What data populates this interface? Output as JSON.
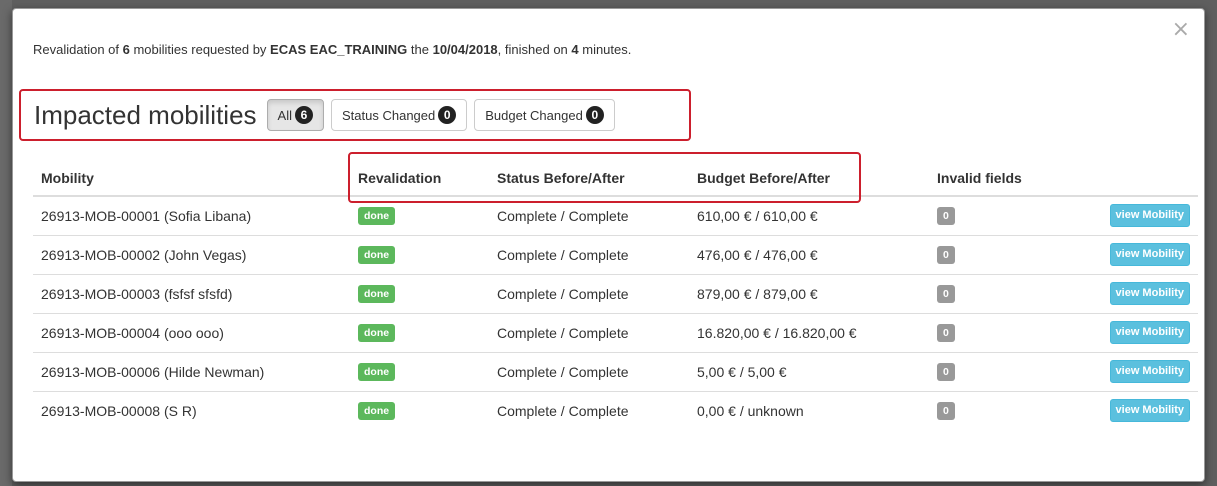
{
  "summary": {
    "prefix": "Revalidation of ",
    "count": "6",
    "middle": " mobilities requested by ",
    "requester": "ECAS EAC_TRAINING",
    "the": " the ",
    "date": "10/04/2018",
    "finished": ", finished on ",
    "minutes": "4",
    "suffix": " minutes."
  },
  "close_glyph": "×",
  "heading": "Impacted mobilities",
  "tabs": [
    {
      "label": "All",
      "count": "6"
    },
    {
      "label": "Status Changed",
      "count": "0"
    },
    {
      "label": "Budget Changed",
      "count": "0"
    }
  ],
  "table": {
    "headers": [
      "Mobility",
      "Revalidation",
      "Status Before/After",
      "Budget Before/After",
      "Invalid fields"
    ],
    "rows": [
      {
        "mobility": "26913-MOB-00001 (Sofia Libana)",
        "revalidation": "done",
        "status": "Complete / Complete",
        "budget": "610,00 € / 610,00 €",
        "invalid": "0",
        "action": "view Mobility"
      },
      {
        "mobility": "26913-MOB-00002 (John Vegas)",
        "revalidation": "done",
        "status": "Complete / Complete",
        "budget": "476,00 € / 476,00 €",
        "invalid": "0",
        "action": "view Mobility"
      },
      {
        "mobility": "26913-MOB-00003 (fsfsf sfsfd)",
        "revalidation": "done",
        "status": "Complete / Complete",
        "budget": "879,00 € / 879,00 €",
        "invalid": "0",
        "action": "view Mobility"
      },
      {
        "mobility": "26913-MOB-00004 (ooo ooo)",
        "revalidation": "done",
        "status": "Complete / Complete",
        "budget": "16.820,00 € / 16.820,00 €",
        "invalid": "0",
        "action": "view Mobility"
      },
      {
        "mobility": "26913-MOB-00006 (Hilde Newman)",
        "revalidation": "done",
        "status": "Complete / Complete",
        "budget": "5,00 € / 5,00 €",
        "invalid": "0",
        "action": "view Mobility"
      },
      {
        "mobility": "26913-MOB-00008 (S R)",
        "revalidation": "done",
        "status": "Complete / Complete",
        "budget": "0,00 € / unknown",
        "invalid": "0",
        "action": "view Mobility"
      }
    ]
  },
  "colors": {
    "highlight_border": "#cc1f2d",
    "done_label": "#5cb85c",
    "invalid_label": "#999999",
    "view_button": "#5bc0de",
    "badge": "#222222"
  }
}
